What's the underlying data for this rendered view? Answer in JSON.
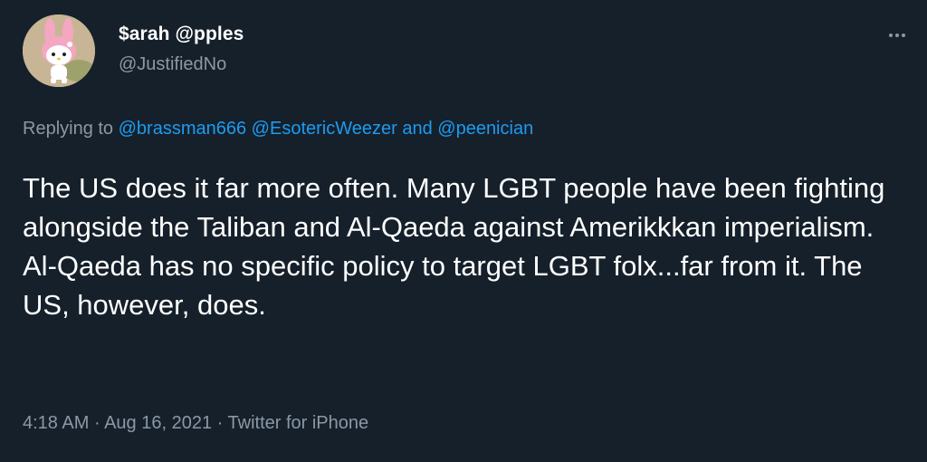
{
  "author": {
    "display_name": "$arah @pples",
    "handle": "@JustifiedNo",
    "avatar_icon": "my-melody-bunny-icon"
  },
  "more_icon": "more-options-icon",
  "reply_context": {
    "prefix": "Replying to",
    "mentions": [
      "@brassman666",
      "@EsotericWeezer"
    ],
    "joiner": "and",
    "last_mention": "@peenician"
  },
  "tweet": {
    "text": "The US does it far more often. Many LGBT people have been fighting alongside the Taliban and Al-Qaeda against Amerikkkan imperialism. Al-Qaeda has no specific policy to target LGBT folx...far from it. The US, however, does."
  },
  "meta": {
    "time": "4:18 AM",
    "separator": "·",
    "date": "Aug 16, 2021",
    "source": "Twitter for iPhone"
  },
  "colors": {
    "background": "#15202b",
    "text": "#ffffff",
    "secondary": "#8b98a5",
    "link": "#1d9bf0"
  }
}
